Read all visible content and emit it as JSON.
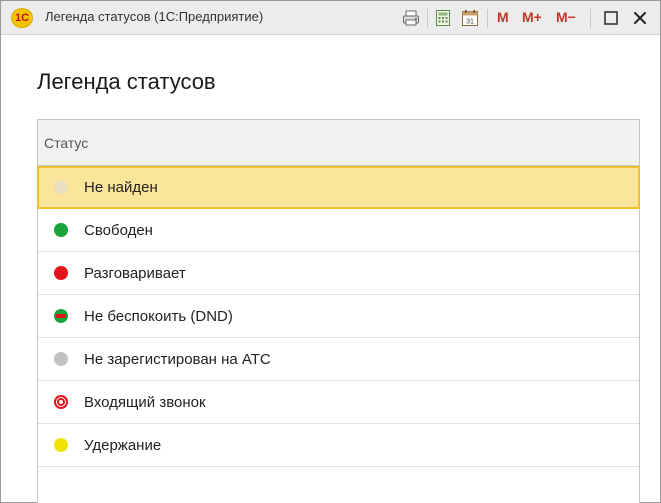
{
  "window": {
    "logo_text": "1С",
    "title": "Легенда статусов  (1С:Предприятие)",
    "toolbar": {
      "print_icon": "printer-icon",
      "calculator_icon": "calculator-icon",
      "calendar_icon": "calendar-icon",
      "m_label": "M",
      "m_plus_label": "M+",
      "m_minus_label": "M−",
      "maximize_icon": "maximize-icon",
      "close_icon": "close-icon"
    }
  },
  "page": {
    "title": "Легенда статусов"
  },
  "table": {
    "column_header": "Статус",
    "rows": [
      {
        "label": "Не найден",
        "icon": "status-not-found-icon",
        "color": "#e8e0c0",
        "selected": true
      },
      {
        "label": "Свободен",
        "icon": "status-free-icon",
        "color": "#1aa33a"
      },
      {
        "label": "Разговаривает",
        "icon": "status-talking-icon",
        "color": "#e3141a"
      },
      {
        "label": "Не беспокоить (DND)",
        "icon": "status-dnd-icon",
        "color": "#1aa33a"
      },
      {
        "label": "Не зарегистирован на АТС",
        "icon": "status-unregistered-icon",
        "color": "#c2c2c2"
      },
      {
        "label": "Входящий звонок",
        "icon": "status-incoming-call-icon",
        "color": "#e3141a"
      },
      {
        "label": "Удержание",
        "icon": "status-hold-icon",
        "color": "#f2e200"
      }
    ]
  }
}
